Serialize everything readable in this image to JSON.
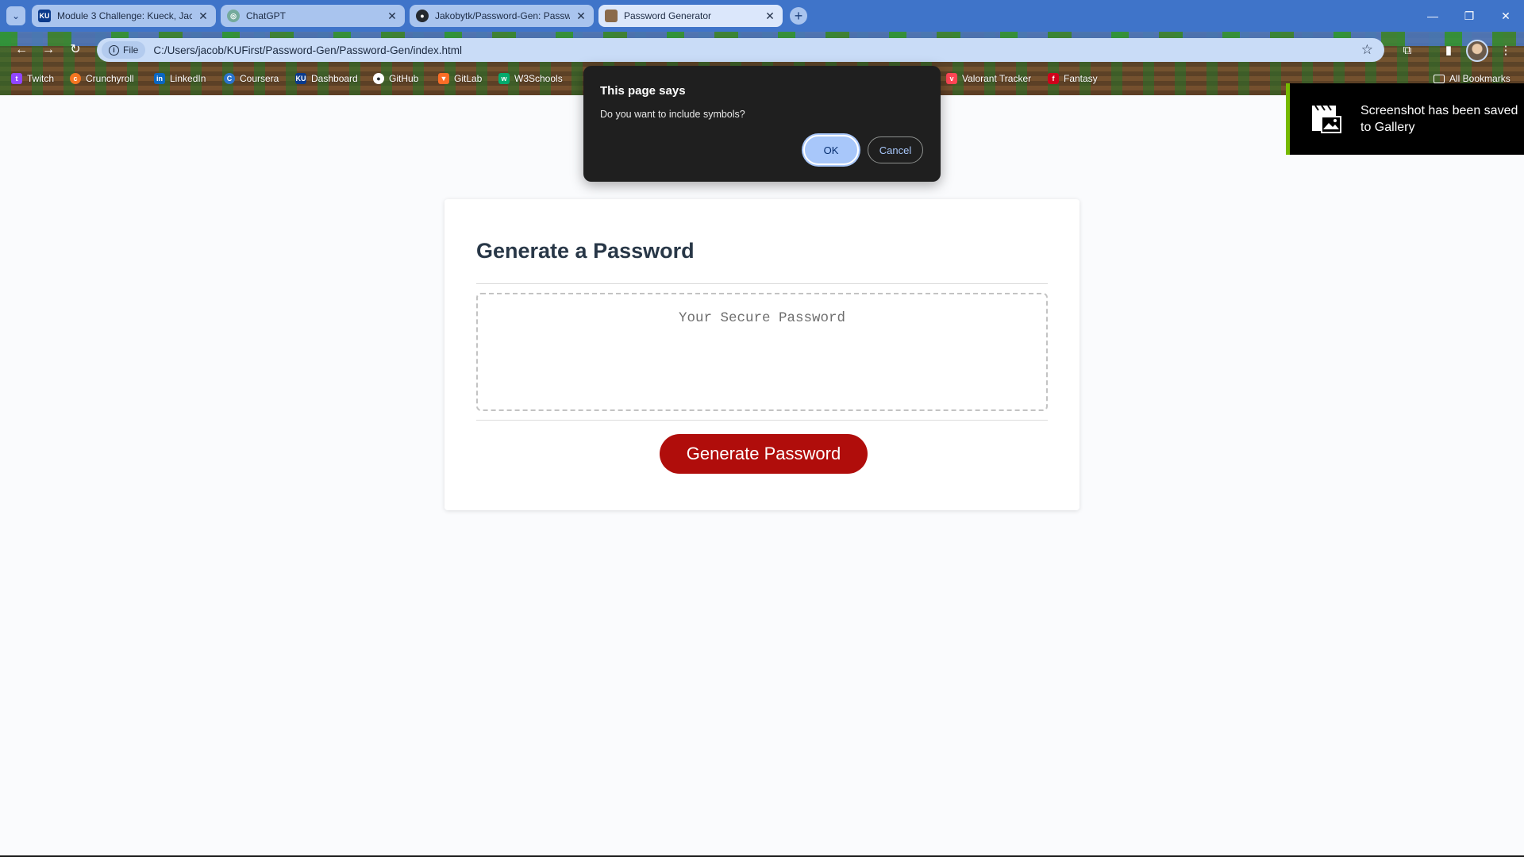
{
  "browser": {
    "tabs": [
      {
        "title": "Module 3 Challenge: Kueck, Jac",
        "favicon": "KU",
        "favicon_color": "#0a3a8c"
      },
      {
        "title": "ChatGPT",
        "favicon": "◎",
        "favicon_color": "#74aa9c"
      },
      {
        "title": "Jakobytk/Password-Gen: Passw",
        "favicon": "●",
        "favicon_color": "#24292f"
      },
      {
        "title": "Password Generator",
        "favicon": "",
        "favicon_color": "#8a6a4a"
      }
    ],
    "tab_close_glyph": "✕",
    "new_tab_glyph": "+",
    "window_controls": {
      "minimize": "—",
      "restore": "❐",
      "close": "✕"
    },
    "address": {
      "scheme_chip": "File",
      "url": "C:/Users/jacob/KUFirst/Password-Gen/Password-Gen/index.html"
    },
    "bookmarks": [
      {
        "label": "Twitch",
        "color": "#9146ff"
      },
      {
        "label": "Crunchyroll",
        "color": "#f47521"
      },
      {
        "label": "LinkedIn",
        "color": "#0a66c2"
      },
      {
        "label": "Coursera",
        "color": "#2a73cc"
      },
      {
        "label": "Dashboard",
        "color": "#0a3a8c"
      },
      {
        "label": "GitHub",
        "color": "#ffffff"
      },
      {
        "label": "GitLab",
        "color": "#fc6d26"
      },
      {
        "label": "W3Schools",
        "color": "#04aa6d"
      },
      {
        "label": "Valorant Tracker",
        "color": "#ff4655"
      },
      {
        "label": "Fantasy",
        "color": "#d0021b"
      }
    ],
    "all_bookmarks_label": "All Bookmarks"
  },
  "page": {
    "heading": "Generate a Password",
    "password_placeholder": "Your Secure Password",
    "generate_button": "Generate Password",
    "accent_color": "#b00d0b"
  },
  "dialog": {
    "title": "This page says",
    "message": "Do you want to include symbols?",
    "ok_label": "OK",
    "cancel_label": "Cancel"
  },
  "toast": {
    "message": "Screenshot has been saved to Gallery",
    "accent_color": "#76b900"
  }
}
